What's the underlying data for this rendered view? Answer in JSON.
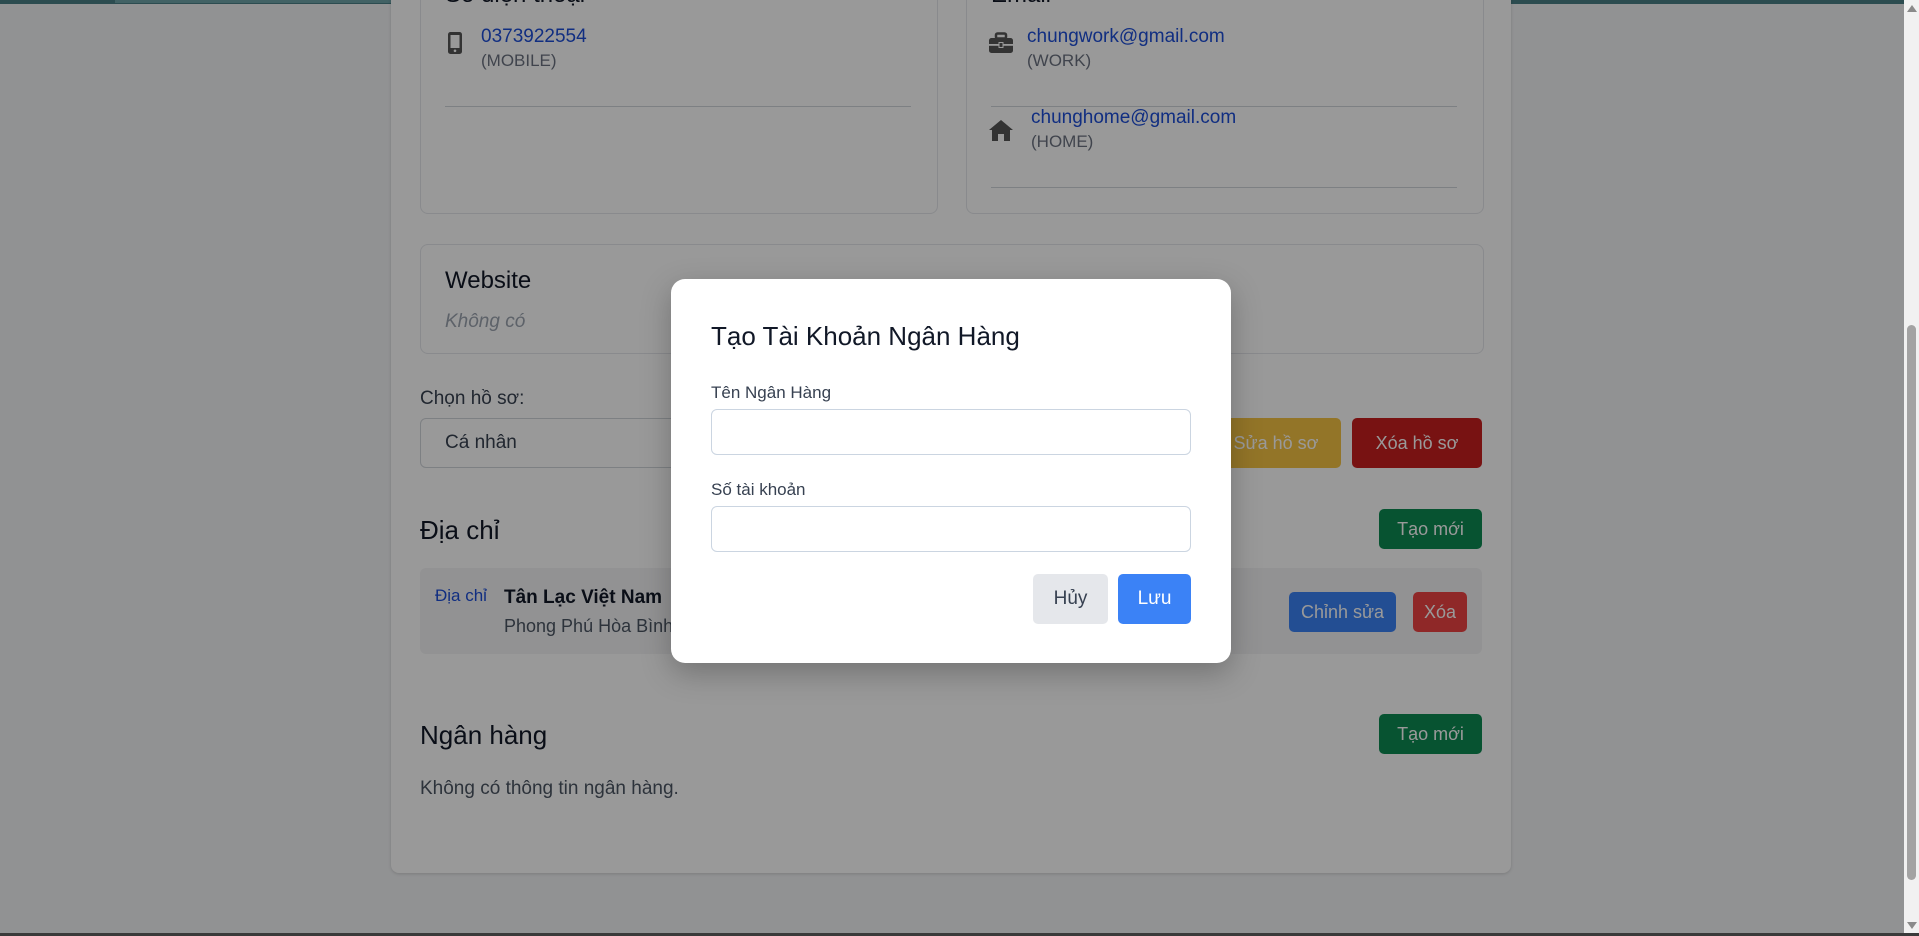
{
  "contact": {
    "phone_title": "Số điện thoại",
    "phones": [
      {
        "value": "0373922554",
        "type": "(MOBILE)",
        "icon": "mobile-phone-icon"
      }
    ],
    "email_title": "Email",
    "emails": [
      {
        "value": "chungwork@gmail.com",
        "type": "(WORK)",
        "icon": "briefcase-icon"
      },
      {
        "value": "chunghome@gmail.com",
        "type": "(HOME)",
        "icon": "home-icon"
      }
    ]
  },
  "website": {
    "title": "Website",
    "empty_text": "Không có"
  },
  "profile": {
    "label": "Chọn hồ sơ:",
    "selected": "Cá nhân",
    "edit_label": "Sửa hồ sơ",
    "delete_label": "Xóa hồ sơ"
  },
  "address": {
    "title": "Địa chỉ",
    "create_label": "Tạo mới",
    "items": [
      {
        "tag": "Địa chỉ",
        "name": "Tân Lạc Việt Nam",
        "line": "Phong Phú Hòa Bình",
        "edit_label": "Chỉnh sửa",
        "delete_label": "Xóa"
      }
    ]
  },
  "bank": {
    "title": "Ngân hàng",
    "create_label": "Tạo mới",
    "empty_text": "Không có thông tin ngân hàng."
  },
  "modal": {
    "title": "Tạo Tài Khoản Ngân Hàng",
    "bank_name_label": "Tên Ngân Hàng",
    "bank_name_value": "",
    "account_label": "Số tài khoản",
    "account_value": "",
    "cancel_label": "Hủy",
    "save_label": "Lưu"
  },
  "colors": {
    "primary": "#3b82f6",
    "success": "#0d8a52",
    "danger": "#c81e1e",
    "warning": "#f6c344",
    "link": "#1d4ed8"
  }
}
